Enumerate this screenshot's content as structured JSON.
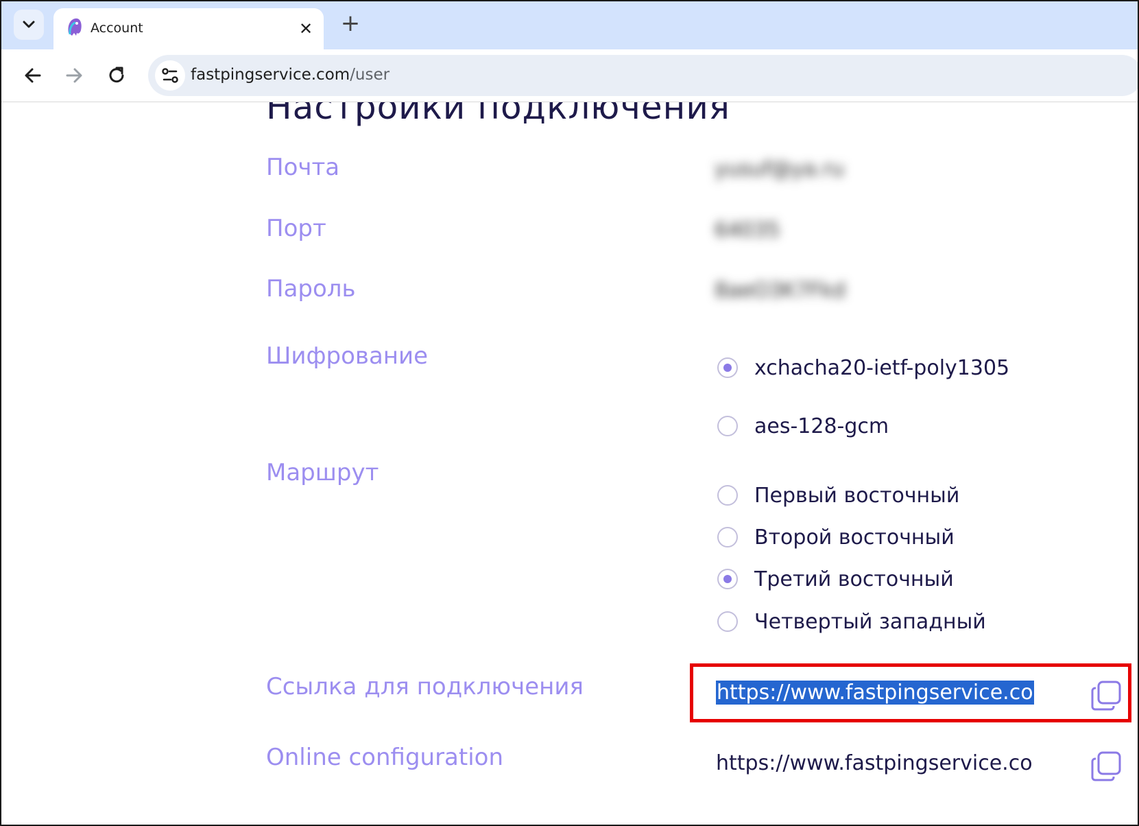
{
  "browser": {
    "tab_title": "Account",
    "tab_close": "✕",
    "new_tab": "+",
    "url_domain": "fastpingservice.com",
    "url_path": "/user"
  },
  "page": {
    "title": "Настройки подключения",
    "fields": {
      "email_label": "Почта",
      "email_value": "yusuf@ya.ru",
      "port_label": "Порт",
      "port_value": "64035",
      "password_label": "Пароль",
      "password_value": "8aeO3K7Fkd"
    },
    "encryption": {
      "label": "Шифрование",
      "options": [
        {
          "label": "xchacha20-ietf-poly1305",
          "checked": true
        },
        {
          "label": "aes-128-gcm",
          "checked": false
        }
      ]
    },
    "route": {
      "label": "Маршрут",
      "options": [
        {
          "label": "Первый восточный",
          "checked": false
        },
        {
          "label": "Второй восточный",
          "checked": false
        },
        {
          "label": "Третий восточный",
          "checked": true
        },
        {
          "label": "Четвертый западный",
          "checked": false
        }
      ]
    },
    "connection_link": {
      "label": "Ссылка для подключения",
      "value": "https://www.fastpingservice.co"
    },
    "online_config": {
      "label": "Online configuration",
      "value": "https://www.fastpingservice.co"
    }
  },
  "colors": {
    "label": "#9c8ef0",
    "text": "#1e1a4a",
    "radio_checked": "#8b7ae6",
    "selection": "#2566d0",
    "annotation": "#e60000"
  }
}
